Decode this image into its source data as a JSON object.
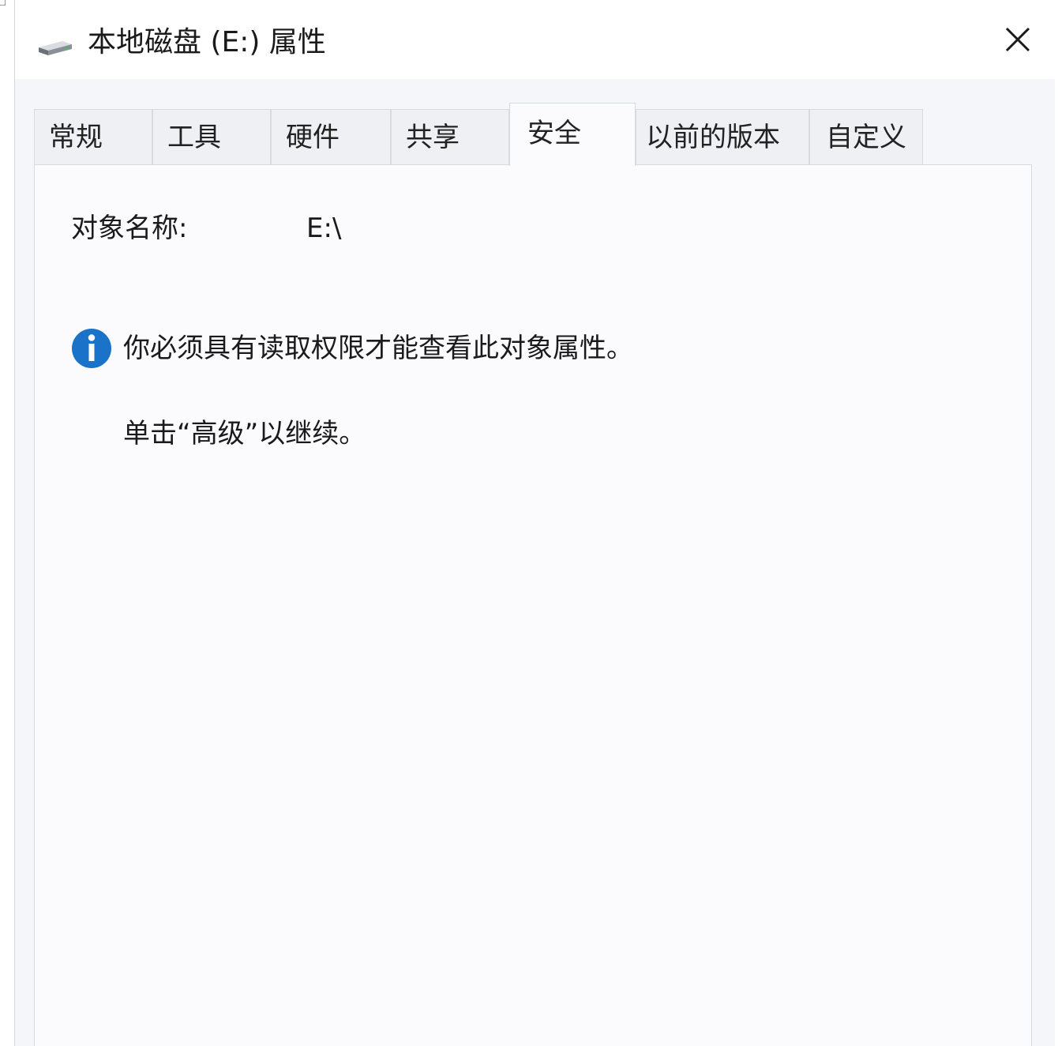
{
  "window": {
    "title": "本地磁盘 (E:) 属性",
    "icon": "drive-icon",
    "close_icon": "close-icon"
  },
  "tabs": [
    {
      "label": "常规",
      "active": false
    },
    {
      "label": "工具",
      "active": false
    },
    {
      "label": "硬件",
      "active": false
    },
    {
      "label": "共享",
      "active": false
    },
    {
      "label": "安全",
      "active": true
    },
    {
      "label": "以前的版本",
      "active": false
    },
    {
      "label": "自定义",
      "active": false
    }
  ],
  "security": {
    "object_name_label": "对象名称:",
    "object_name_value": "E:\\",
    "info_icon": "info-icon",
    "info_message": "你必须具有读取权限才能查看此对象属性。",
    "hint_message": "单击“高级”以继续。"
  },
  "colors": {
    "info_blue": "#1a73c8",
    "window_bg": "#f4f6f9",
    "panel_bg": "#fbfbfd",
    "border": "#d7dadf"
  }
}
